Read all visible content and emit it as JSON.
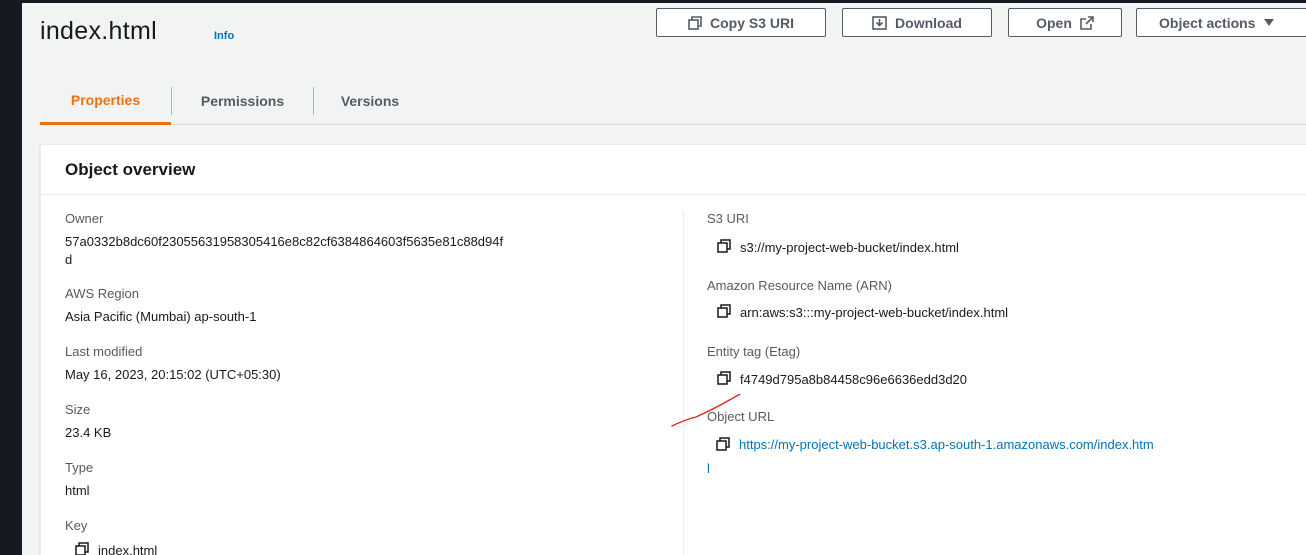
{
  "header": {
    "title": "index.html",
    "info": "Info",
    "buttons": {
      "copy_s3_uri": "Copy S3 URI",
      "download": "Download",
      "open": "Open",
      "object_actions": "Object actions"
    }
  },
  "tabs": [
    {
      "label": "Properties",
      "active": true
    },
    {
      "label": "Permissions",
      "active": false
    },
    {
      "label": "Versions",
      "active": false
    }
  ],
  "overview": {
    "title": "Object overview",
    "left": {
      "owner": {
        "label": "Owner",
        "value_line1": "57a0332b8dc60f23055631958305416e8c82cf6384864603f5635e81c88d94f",
        "value_line2": "d"
      },
      "region": {
        "label": "AWS Region",
        "value": "Asia Pacific (Mumbai) ap-south-1"
      },
      "last_modified": {
        "label": "Last modified",
        "value": "May 16, 2023, 20:15:02 (UTC+05:30)"
      },
      "size": {
        "label": "Size",
        "value": "23.4 KB"
      },
      "type": {
        "label": "Type",
        "value": "html"
      },
      "key": {
        "label": "Key",
        "value": "index.html"
      }
    },
    "right": {
      "s3_uri": {
        "label": "S3 URI",
        "value": "s3://my-project-web-bucket/index.html"
      },
      "arn": {
        "label": "Amazon Resource Name (ARN)",
        "value": "arn:aws:s3:::my-project-web-bucket/index.html"
      },
      "etag": {
        "label": "Entity tag (Etag)",
        "value": "f4749d795a8b84458c96e6636edd3d20"
      },
      "object_url": {
        "label": "Object URL",
        "value_line1": "https://my-project-web-bucket.s3.ap-south-1.amazonaws.com/index.htm",
        "value_line2": "l"
      }
    }
  },
  "colors": {
    "accent": "#ec7211",
    "link": "#0073bb",
    "annotation": "#e0251b"
  }
}
